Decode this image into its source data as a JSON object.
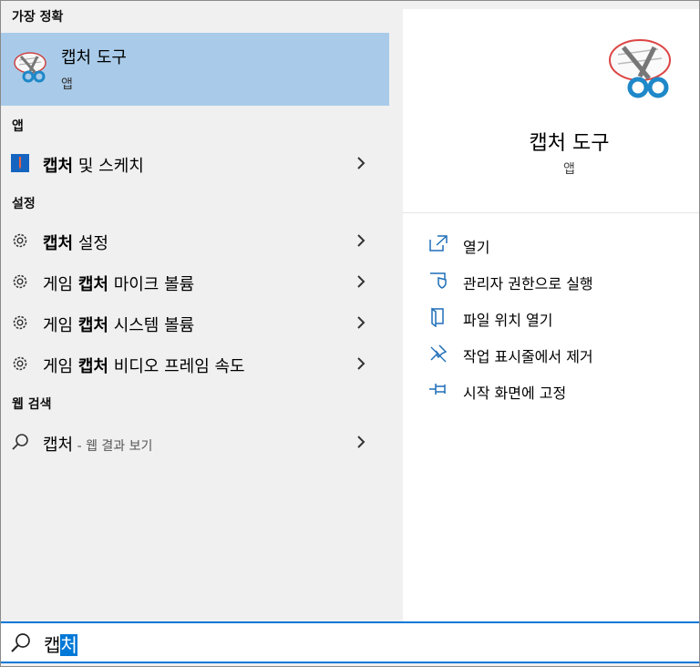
{
  "sections": {
    "best_match": "가장 정확",
    "apps": "앱",
    "settings": "설정",
    "web": "웹 검색"
  },
  "best": {
    "title": "캡처 도구",
    "sub": "앱"
  },
  "apps": [
    {
      "bold": "캡처",
      "rest": " 및 스케치"
    }
  ],
  "settings": [
    {
      "pre": "",
      "bold": "캡처",
      "rest": " 설정"
    },
    {
      "pre": "게임 ",
      "bold": "캡처",
      "rest": " 마이크 볼륨"
    },
    {
      "pre": "게임 ",
      "bold": "캡처",
      "rest": " 시스템 볼륨"
    },
    {
      "pre": "게임 ",
      "bold": "캡처",
      "rest": " 비디오 프레임 속도"
    }
  ],
  "web": {
    "query": "캡처",
    "hint": " - 웹 결과 보기"
  },
  "detail": {
    "title": "캡처 도구",
    "sub": "앱",
    "actions": [
      {
        "label": "열기",
        "icon": "open-icon"
      },
      {
        "label": "관리자 권한으로 실행",
        "icon": "shield-icon"
      },
      {
        "label": "파일 위치 열기",
        "icon": "file-location-icon"
      },
      {
        "label": "작업 표시줄에서 제거",
        "icon": "unpin-taskbar-icon"
      },
      {
        "label": "시작 화면에 고정",
        "icon": "pin-start-icon"
      }
    ]
  },
  "search": {
    "typed": "캡",
    "selected": "처"
  },
  "colors": {
    "accent": "#0078d7",
    "highlight": "#a9cbe9"
  }
}
